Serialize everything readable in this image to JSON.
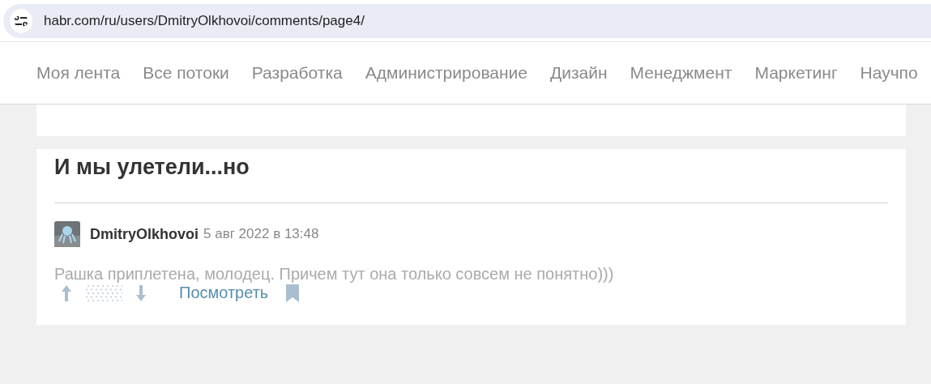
{
  "address_bar": {
    "url": "habr.com/ru/users/DmitryOlkhovoi/comments/page4/"
  },
  "nav": {
    "items": [
      {
        "label": "Моя лента"
      },
      {
        "label": "Все потоки"
      },
      {
        "label": "Разработка"
      },
      {
        "label": "Администрирование"
      },
      {
        "label": "Дизайн"
      },
      {
        "label": "Менеджмент"
      },
      {
        "label": "Маркетинг"
      },
      {
        "label": "Научпо"
      }
    ]
  },
  "comments": [
    {
      "post_title": "И мы улетели...но",
      "author": "DmitryOlkhovoi",
      "date": "5 авг 2022 в 13:48",
      "text": "Рашка приплетена, молодец. Причем тут она только совсем не понятно)))",
      "actions": {
        "link": "Посмотреть"
      }
    }
  ]
}
